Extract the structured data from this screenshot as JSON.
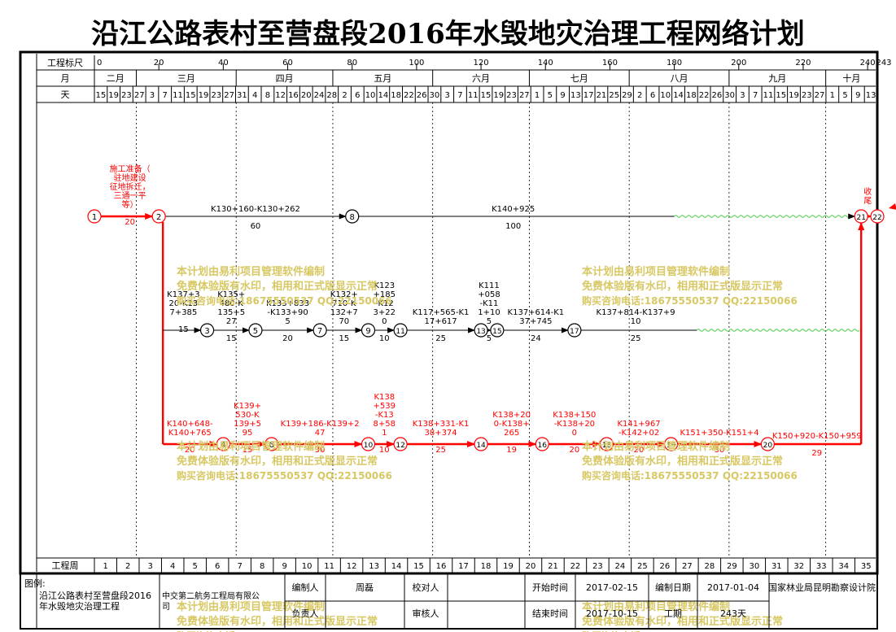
{
  "title": "沿江公路表村至营盘段2016年水毁地灾治理工程网络计划",
  "scale": {
    "label": "工程标尺",
    "ticks": [
      0,
      20,
      40,
      60,
      80,
      100,
      120,
      140,
      160,
      180,
      200,
      220,
      240
    ],
    "end_label": "243"
  },
  "months": {
    "label": "月",
    "items": [
      {
        "name": "二月",
        "from": 0,
        "to": 13
      },
      {
        "name": "三月",
        "from": 13,
        "to": 44
      },
      {
        "name": "四月",
        "from": 44,
        "to": 74
      },
      {
        "name": "五月",
        "from": 74,
        "to": 105
      },
      {
        "name": "六月",
        "from": 105,
        "to": 135
      },
      {
        "name": "七月",
        "from": 135,
        "to": 166
      },
      {
        "name": "八月",
        "from": 166,
        "to": 197
      },
      {
        "name": "九月",
        "from": 197,
        "to": 227
      },
      {
        "name": "十月",
        "from": 227,
        "to": 243
      }
    ]
  },
  "days": {
    "label": "天",
    "values": [
      "15",
      "19",
      "23",
      "27",
      "3",
      "7",
      "11",
      "15",
      "19",
      "23",
      "27",
      "31",
      "4",
      "8",
      "12",
      "16",
      "20",
      "24",
      "28",
      "2",
      "6",
      "10",
      "14",
      "18",
      "22",
      "26",
      "30",
      "3",
      "7",
      "11",
      "15",
      "19",
      "23",
      "27",
      "1",
      "5",
      "9",
      "13",
      "17",
      "21",
      "25",
      "29",
      "2",
      "6",
      "10",
      "14",
      "18",
      "22",
      "26",
      "30",
      "3",
      "7",
      "11",
      "15",
      "19",
      "23",
      "27",
      "1",
      "5",
      "9",
      "13"
    ]
  },
  "weeks": {
    "label": "工程周",
    "values": [
      "1",
      "2",
      "3",
      "4",
      "5",
      "6",
      "7",
      "8",
      "9",
      "10",
      "11",
      "12",
      "13",
      "14",
      "15",
      "16",
      "17",
      "18",
      "19",
      "20",
      "21",
      "22",
      "23",
      "24",
      "25",
      "26",
      "27",
      "28",
      "29",
      "30",
      "31",
      "32",
      "33",
      "34",
      "35"
    ]
  },
  "watermark": {
    "line1": "本计划由易利项目管理软件编制",
    "line2": "免费体验版有水印，相用和正式版显示正常",
    "line3": "购买咨询电话:18675550537 QQ:22150066"
  },
  "chart_data": {
    "type": "network",
    "x_unit": "day",
    "x_range": [
      0,
      243
    ],
    "lanes": [
      "top",
      "middle",
      "critical"
    ],
    "nodes": [
      {
        "id": "1",
        "day": 0,
        "lane": "top"
      },
      {
        "id": "2",
        "day": 20,
        "lane": "top"
      },
      {
        "id": "8",
        "day": 80,
        "lane": "top"
      },
      {
        "id": "3",
        "day": 35,
        "lane": "middle"
      },
      {
        "id": "5",
        "day": 50,
        "lane": "middle"
      },
      {
        "id": "7",
        "day": 70,
        "lane": "middle"
      },
      {
        "id": "9",
        "day": 85,
        "lane": "middle"
      },
      {
        "id": "11",
        "day": 95,
        "lane": "middle"
      },
      {
        "id": "13",
        "day": 120,
        "lane": "middle"
      },
      {
        "id": "15",
        "day": 125,
        "lane": "middle"
      },
      {
        "id": "17",
        "day": 149,
        "lane": "middle"
      },
      {
        "id": "4",
        "day": 40,
        "lane": "critical"
      },
      {
        "id": "6",
        "day": 55,
        "lane": "critical"
      },
      {
        "id": "10",
        "day": 85,
        "lane": "critical"
      },
      {
        "id": "12",
        "day": 95,
        "lane": "critical"
      },
      {
        "id": "14",
        "day": 120,
        "lane": "critical"
      },
      {
        "id": "16",
        "day": 139,
        "lane": "critical"
      },
      {
        "id": "18",
        "day": 159,
        "lane": "critical"
      },
      {
        "id": "19",
        "day": 179,
        "lane": "critical"
      },
      {
        "id": "20",
        "day": 209,
        "lane": "critical"
      },
      {
        "id": "21",
        "day": 238,
        "lane": "top"
      },
      {
        "id": "22",
        "day": 243,
        "lane": "top"
      }
    ],
    "activities": [
      {
        "from": "1",
        "to": "2",
        "label": "施工准备（驻地建设、征地拆迁、三通一平等）",
        "duration": "20",
        "critical": true
      },
      {
        "from": "2",
        "to": "8",
        "label": "K130+160-K130+262",
        "duration": "60",
        "critical": false
      },
      {
        "from": "8",
        "to": "21",
        "label": "K140+925",
        "duration": "100",
        "critical": false
      },
      {
        "from": "2",
        "to": "3",
        "label": "K137+320-K137+385",
        "duration": "15",
        "critical": false
      },
      {
        "from": "3",
        "to": "5",
        "label": "K135+480-K135+527",
        "duration": "15",
        "critical": false
      },
      {
        "from": "5",
        "to": "7",
        "label": "K133+833-K133+905",
        "duration": "20",
        "critical": false
      },
      {
        "from": "7",
        "to": "9",
        "label": "K132+710-K132+770",
        "duration": "15",
        "critical": false
      },
      {
        "from": "9",
        "to": "11",
        "label": "K123+185-K123+220",
        "duration": "10",
        "critical": false
      },
      {
        "from": "11",
        "to": "13",
        "label": "K117+565-K117+617",
        "duration": "25",
        "critical": false
      },
      {
        "from": "13",
        "to": "15",
        "label": "K111+058-K111+105",
        "duration": "5",
        "critical": false
      },
      {
        "from": "15",
        "to": "17",
        "label": "K137+614-K137+745",
        "duration": "24",
        "critical": false
      },
      {
        "from": "17",
        "to": "21",
        "label": "K137+814-K137+910",
        "duration": "25",
        "critical": false
      },
      {
        "from": "2",
        "to": "4",
        "label": "K140+648-K140+765",
        "duration": "20",
        "critical": true
      },
      {
        "from": "4",
        "to": "6",
        "label": "K139+530-K139+595",
        "duration": "15",
        "critical": true
      },
      {
        "from": "6",
        "to": "10",
        "label": "K139+186-K139+247",
        "duration": "30",
        "critical": true
      },
      {
        "from": "10",
        "to": "12",
        "label": "K138+539-K138+581",
        "duration": "10",
        "critical": true
      },
      {
        "from": "12",
        "to": "14",
        "label": "K138+331-K138+374",
        "duration": "25",
        "critical": true
      },
      {
        "from": "14",
        "to": "16",
        "label": "K138+200-K138+265",
        "duration": "19",
        "critical": true
      },
      {
        "from": "16",
        "to": "18",
        "label": "K138+150-K138+200",
        "duration": "20",
        "critical": true
      },
      {
        "from": "18",
        "to": "19",
        "label": "K141+967-K142+02",
        "duration": "20",
        "critical": true
      },
      {
        "from": "19",
        "to": "20",
        "label": "K151+350-K151+4",
        "duration": "30",
        "critical": true
      },
      {
        "from": "20",
        "to": "21",
        "label": "K150+920-K150+959",
        "duration": "29",
        "critical": true
      },
      {
        "from": "21",
        "to": "22",
        "label": "收尾",
        "duration": "",
        "critical": true
      }
    ],
    "labels": {
      "a12": {
        "lines": [
          "施工准备（",
          "驻地建设",
          "征地拆迁，",
          "三通一平",
          "等）"
        ],
        "dur": "20"
      },
      "a28": {
        "lines": [
          "K130+160-K130+262"
        ],
        "dur": "60"
      },
      "a8_21": {
        "lines": [
          "K140+925"
        ],
        "dur": "100"
      },
      "a23": {
        "lines": [
          "K137+3",
          "20-K13",
          "7+385"
        ],
        "dur": "15"
      },
      "a35": {
        "lines": [
          "K135+",
          "480-K",
          "135+5",
          "27"
        ],
        "dur": "15"
      },
      "a57": {
        "lines": [
          "K133+833",
          "-K133+90",
          "5"
        ],
        "dur": "20"
      },
      "a79": {
        "lines": [
          "K132+",
          "710-K",
          "132+7",
          "70"
        ],
        "dur": "15"
      },
      "a911": {
        "lines": [
          "K123",
          "+185",
          "-K12",
          "3+22",
          "0"
        ],
        "dur": "10"
      },
      "a1113": {
        "lines": [
          "K117+565-K1",
          "17+617"
        ],
        "dur": "25"
      },
      "a1315": {
        "lines": [
          "K111",
          "+058",
          "-K11",
          "1+10",
          "5"
        ],
        "dur": "5"
      },
      "a1517": {
        "lines": [
          "K137+614-K1",
          "37+745"
        ],
        "dur": "24"
      },
      "a1721": {
        "lines": [
          "K137+814-K137+9",
          "10"
        ],
        "dur": "25"
      },
      "a24": {
        "lines": [
          "K140+648-",
          "K140+765"
        ],
        "dur": "20"
      },
      "a46": {
        "lines": [
          "K139+",
          "530-K",
          "139+5",
          "95"
        ],
        "dur": "15"
      },
      "a610": {
        "lines": [
          "K139+186-K139+2",
          "47"
        ],
        "dur": "30"
      },
      "a1012": {
        "lines": [
          "K138",
          "+539",
          "-K13",
          "8+58",
          "1"
        ],
        "dur": "10"
      },
      "a1214": {
        "lines": [
          "K138+331-K1",
          "38+374"
        ],
        "dur": "25"
      },
      "a1416": {
        "lines": [
          "K138+20",
          "0-K138+",
          "265"
        ],
        "dur": "19"
      },
      "a1618": {
        "lines": [
          "K138+150",
          "-K138+20",
          "0"
        ],
        "dur": "20"
      },
      "a1819": {
        "lines": [
          "K141+967",
          "-K142+02"
        ],
        "dur": "20"
      },
      "a1920": {
        "lines": [
          "K151+350-K151+4"
        ],
        "dur": "30"
      },
      "a2021": {
        "lines": [
          "K150+920-K150+959"
        ],
        "dur": "29"
      },
      "a2122": {
        "lines": [
          "收",
          "尾"
        ],
        "dur": ""
      }
    }
  },
  "footer": {
    "legend_label": "图例:",
    "project": "沿江公路表村至营盘段2016年水毁地灾治理工程",
    "company": "中交第二航务工程局有限公司",
    "compiler_label": "编制人",
    "compiler": "周磊",
    "checker_label": "校对人",
    "checker": "",
    "principal_label": "负责人",
    "principal": "",
    "reviewer_label": "审核人",
    "reviewer": "",
    "start_label": "开始时间",
    "start": "2017-02-15",
    "end_label": "结束时间",
    "end": "2017-10-15",
    "date_label": "编制日期",
    "date": "2017-01-04",
    "duration_label": "工期",
    "duration": "243天",
    "designer": "国家林业局昆明勘察设计院"
  }
}
